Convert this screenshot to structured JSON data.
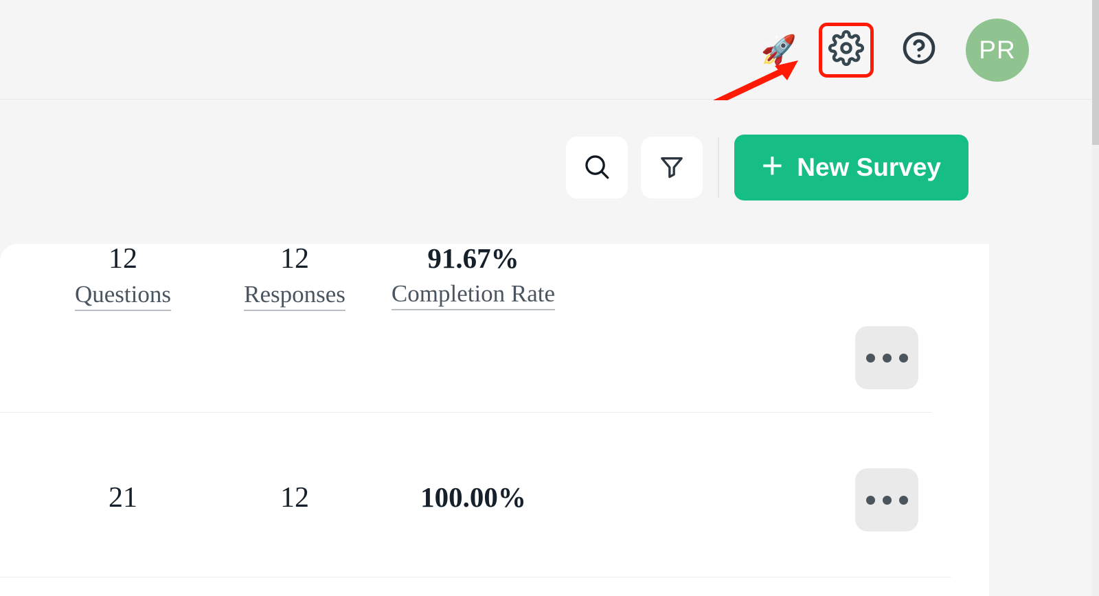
{
  "header": {
    "rocket_icon_label": "rocket-icon",
    "rocket_glyph": "🚀",
    "gear_icon_label": "gear-icon",
    "help_icon_label": "help-icon",
    "avatar_initials": "PR",
    "avatar_color": "#8fc490",
    "highlight_color": "#ff1a05"
  },
  "annotation": {
    "type": "arrow",
    "color": "#ff1a05",
    "points_to": "gear-icon"
  },
  "toolbar": {
    "search_icon_label": "search-icon",
    "filter_icon_label": "filter-icon",
    "new_survey_label": "New Survey",
    "new_survey_plus": "+",
    "accent_color": "#16bd84"
  },
  "surveys": {
    "columns": [
      "Questions",
      "Responses",
      "Completion Rate"
    ],
    "rows": [
      {
        "questions": "12",
        "responses": "12",
        "completion_rate": "91.67%",
        "questions_label": "Questions",
        "responses_label": "Responses",
        "completion_label": "Completion Rate",
        "more_label": "•••"
      },
      {
        "questions": "21",
        "responses": "12",
        "completion_rate": "100.00%",
        "questions_label": "",
        "responses_label": "",
        "completion_label": "",
        "more_label": "•••"
      }
    ]
  },
  "scrollbar": {
    "thumb_color": "#cdcdcd",
    "track_color": "#f0f0f0"
  }
}
